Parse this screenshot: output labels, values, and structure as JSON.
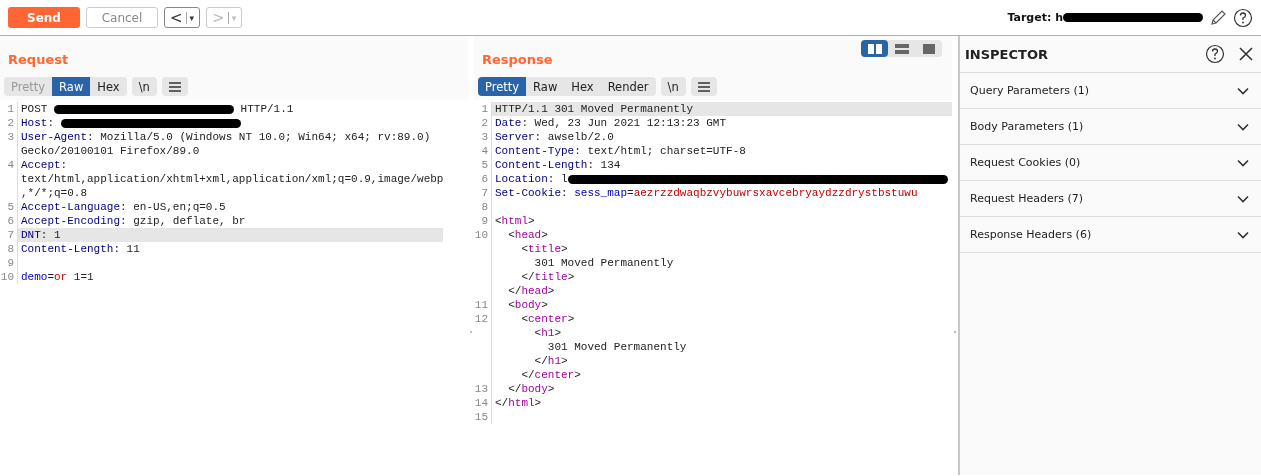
{
  "toolbar": {
    "send": "Send",
    "cancel": "Cancel",
    "back": {
      "label": "<",
      "caret": "▾",
      "disabled": false
    },
    "forward": {
      "label": ">",
      "caret": "▾",
      "disabled": true
    },
    "target_label": "Target: h"
  },
  "request": {
    "title": "Request",
    "tabs": [
      {
        "label": "Pretty",
        "selected": false,
        "disabled": true
      },
      {
        "label": "Raw",
        "selected": true,
        "disabled": false
      },
      {
        "label": "Hex",
        "selected": false,
        "disabled": false
      }
    ],
    "newline_button": "\\n",
    "lines": [
      {
        "num": "1",
        "highlighted": false,
        "segments": [
          {
            "kind": "plain",
            "text": "POST "
          },
          {
            "kind": "redacted"
          },
          {
            "kind": "plain",
            "text": " HTTP/1.1"
          }
        ]
      },
      {
        "num": "2",
        "highlighted": false,
        "segments": [
          {
            "kind": "key",
            "text": "Host"
          },
          {
            "kind": "plain",
            "text": ": "
          },
          {
            "kind": "redacted"
          }
        ]
      },
      {
        "num": "3",
        "highlighted": false,
        "segments": [
          {
            "kind": "key",
            "text": "User-Agent"
          },
          {
            "kind": "plain",
            "text": ": Mozilla/5.0 (Windows NT 10.0; Win64; x64; rv:89.0) Gecko/20100101 Firefox/89.0"
          }
        ]
      },
      {
        "num": "4",
        "highlighted": false,
        "segments": [
          {
            "kind": "key",
            "text": "Accept"
          },
          {
            "kind": "plain",
            "text": ": text/html,application/xhtml+xml,application/xml;q=0.9,image/webp,*/*;q=0.8"
          }
        ]
      },
      {
        "num": "5",
        "highlighted": false,
        "segments": [
          {
            "kind": "key",
            "text": "Accept-Language"
          },
          {
            "kind": "plain",
            "text": ": en-US,en;q=0.5"
          }
        ]
      },
      {
        "num": "6",
        "highlighted": false,
        "segments": [
          {
            "kind": "key",
            "text": "Accept-Encoding"
          },
          {
            "kind": "plain",
            "text": ": gzip, deflate, br"
          }
        ]
      },
      {
        "num": "7",
        "highlighted": true,
        "segments": [
          {
            "kind": "key",
            "text": "DNT"
          },
          {
            "kind": "plain",
            "text": ": 1"
          }
        ]
      },
      {
        "num": "8",
        "highlighted": false,
        "segments": [
          {
            "kind": "key",
            "text": "Content-Length"
          },
          {
            "kind": "plain",
            "text": ": 11"
          }
        ]
      },
      {
        "num": "9",
        "highlighted": false
      },
      {
        "num": "10",
        "highlighted": false,
        "segments": [
          {
            "kind": "param",
            "text": "demo"
          },
          {
            "kind": "plain",
            "text": "="
          },
          {
            "kind": "value",
            "text": "or"
          },
          {
            "kind": "plain",
            "text": " 1=1"
          }
        ]
      }
    ]
  },
  "response": {
    "title": "Response",
    "layout_buttons": [
      {
        "kind": "columns",
        "selected": true
      },
      {
        "kind": "rows",
        "selected": false
      },
      {
        "kind": "single",
        "selected": false
      }
    ],
    "tabs": [
      {
        "label": "Pretty",
        "selected": true,
        "disabled": false
      },
      {
        "label": "Raw",
        "selected": false,
        "disabled": false
      },
      {
        "label": "Hex",
        "selected": false,
        "disabled": false
      },
      {
        "label": "Render",
        "selected": false,
        "disabled": false
      }
    ],
    "newline_button": "\\n",
    "lines": [
      {
        "num": "1",
        "highlighted": true,
        "segments": [
          {
            "kind": "plain",
            "text": "HTTP/1.1 301 Moved Permanently"
          }
        ]
      },
      {
        "num": "2",
        "highlighted": false,
        "segments": [
          {
            "kind": "key",
            "text": "Date"
          },
          {
            "kind": "plain",
            "text": ": Wed, 23 Jun 2021 12:13:23 GMT"
          }
        ]
      },
      {
        "num": "3",
        "highlighted": false,
        "segments": [
          {
            "kind": "key",
            "text": "Server"
          },
          {
            "kind": "plain",
            "text": ": awselb/2.0"
          }
        ]
      },
      {
        "num": "4",
        "highlighted": false,
        "segments": [
          {
            "kind": "key",
            "text": "Content-Type"
          },
          {
            "kind": "plain",
            "text": ": text/html; charset=UTF-8"
          }
        ]
      },
      {
        "num": "5",
        "highlighted": false,
        "segments": [
          {
            "kind": "key",
            "text": "Content-Length"
          },
          {
            "kind": "plain",
            "text": ": 134"
          }
        ]
      },
      {
        "num": "6",
        "highlighted": false,
        "segments": [
          {
            "kind": "key",
            "text": "Location"
          },
          {
            "kind": "plain",
            "text": ": l"
          },
          {
            "kind": "redacted",
            "wide": true
          }
        ]
      },
      {
        "num": "7",
        "highlighted": false,
        "segments": [
          {
            "kind": "key",
            "text": "Set-Cookie"
          },
          {
            "kind": "plain",
            "text": ": "
          },
          {
            "kind": "param",
            "text": "sess_map"
          },
          {
            "kind": "plain",
            "text": "="
          },
          {
            "kind": "value",
            "text": "aezrzzdwaqbzvybuwrsxavcebryaydzzdrystbstuwu"
          }
        ]
      },
      {
        "num": "8",
        "highlighted": false
      },
      {
        "num": "9",
        "highlighted": false,
        "segments": [
          {
            "kind": "plain",
            "text": "<"
          },
          {
            "kind": "tag",
            "text": "html"
          },
          {
            "kind": "plain",
            "text": ">"
          }
        ]
      },
      {
        "num": "10",
        "highlighted": false,
        "segments": [
          {
            "kind": "plain",
            "text": "  <"
          },
          {
            "kind": "tag",
            "text": "head"
          },
          {
            "kind": "plain",
            "text": ">"
          }
        ]
      },
      {
        "highlighted": false,
        "segments": [
          {
            "kind": "plain",
            "text": "    <"
          },
          {
            "kind": "tag",
            "text": "title"
          },
          {
            "kind": "plain",
            "text": ">"
          }
        ]
      },
      {
        "highlighted": false,
        "segments": [
          {
            "kind": "plain",
            "text": "      301 Moved Permanently"
          }
        ]
      },
      {
        "highlighted": false,
        "segments": [
          {
            "kind": "plain",
            "text": "    </"
          },
          {
            "kind": "tag",
            "text": "title"
          },
          {
            "kind": "plain",
            "text": ">"
          }
        ]
      },
      {
        "highlighted": false,
        "segments": [
          {
            "kind": "plain",
            "text": "  </"
          },
          {
            "kind": "tag",
            "text": "head"
          },
          {
            "kind": "plain",
            "text": ">"
          }
        ]
      },
      {
        "num": "11",
        "highlighted": false,
        "segments": [
          {
            "kind": "plain",
            "text": "  <"
          },
          {
            "kind": "tag",
            "text": "body"
          },
          {
            "kind": "plain",
            "text": ">"
          }
        ]
      },
      {
        "num": "12",
        "highlighted": false,
        "segments": [
          {
            "kind": "plain",
            "text": "    <"
          },
          {
            "kind": "tag",
            "text": "center"
          },
          {
            "kind": "plain",
            "text": ">"
          }
        ]
      },
      {
        "highlighted": false,
        "segments": [
          {
            "kind": "plain",
            "text": "      <"
          },
          {
            "kind": "tag",
            "text": "h1"
          },
          {
            "kind": "plain",
            "text": ">"
          }
        ]
      },
      {
        "highlighted": false,
        "segments": [
          {
            "kind": "plain",
            "text": "        301 Moved Permanently"
          }
        ]
      },
      {
        "highlighted": false,
        "segments": [
          {
            "kind": "plain",
            "text": "      </"
          },
          {
            "kind": "tag",
            "text": "h1"
          },
          {
            "kind": "plain",
            "text": ">"
          }
        ]
      },
      {
        "highlighted": false,
        "segments": [
          {
            "kind": "plain",
            "text": "    </"
          },
          {
            "kind": "tag",
            "text": "center"
          },
          {
            "kind": "plain",
            "text": ">"
          }
        ]
      },
      {
        "num": "13",
        "highlighted": false,
        "segments": [
          {
            "kind": "plain",
            "text": "  </"
          },
          {
            "kind": "tag",
            "text": "body"
          },
          {
            "kind": "plain",
            "text": ">"
          }
        ]
      },
      {
        "num": "14",
        "highlighted": false,
        "segments": [
          {
            "kind": "plain",
            "text": "</"
          },
          {
            "kind": "tag",
            "text": "html"
          },
          {
            "kind": "plain",
            "text": ">"
          }
        ]
      },
      {
        "num": "15",
        "highlighted": false
      }
    ]
  },
  "inspector": {
    "title": "INSPECTOR",
    "sections": [
      {
        "label": "Query Parameters (1)",
        "expanded": false
      },
      {
        "label": "Body Parameters (1)",
        "expanded": false
      },
      {
        "label": "Request Cookies (0)",
        "expanded": false
      },
      {
        "label": "Request Headers (7)",
        "expanded": false
      },
      {
        "label": "Response Headers (6)",
        "expanded": false
      }
    ]
  }
}
